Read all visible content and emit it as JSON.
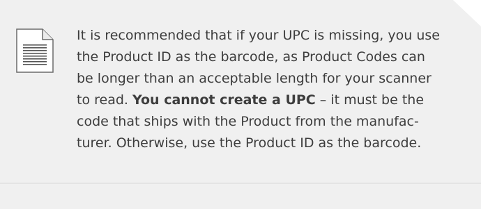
{
  "note": {
    "icon": "document-icon",
    "lines": [
      [
        "It is recommended that if your UPC is missing, you use"
      ],
      [
        "the Product ID as the barcode, as Product Codes can"
      ],
      [
        "be longer than an acceptable length for your scanner"
      ],
      [
        "to read. ",
        "You cannot create a UPC",
        " – it must be the"
      ],
      [
        "code that ships with the Product from the manufac-"
      ],
      [
        "turer. Otherwise, use the Product ID as the barcode."
      ]
    ]
  },
  "colors": {
    "panel": "#f0f0f0",
    "text": "#3d3d3d",
    "divider": "#e4e4e4"
  }
}
